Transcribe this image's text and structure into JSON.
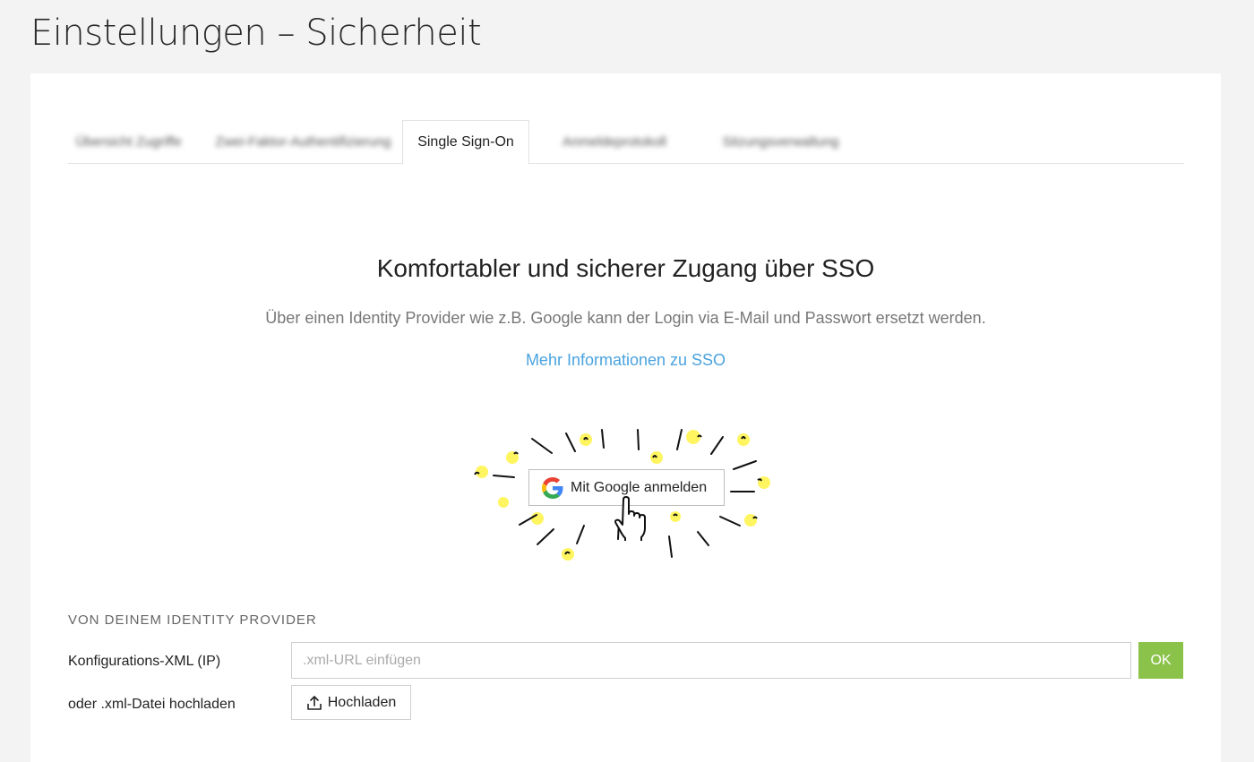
{
  "page": {
    "title": "Einstellungen – Sicherheit"
  },
  "tabs": [
    {
      "label": "Übersicht Zugriffe",
      "active": false,
      "blurred": true
    },
    {
      "label": "Zwei-Faktor-Authentifizierung",
      "active": false,
      "blurred": true
    },
    {
      "label": "Single Sign-On",
      "active": true,
      "blurred": false
    },
    {
      "label": "Anmeldeprotokoll",
      "active": false,
      "blurred": true
    },
    {
      "label": "Sitzungsverwaltung",
      "active": false,
      "blurred": true
    }
  ],
  "sso": {
    "headline": "Komfortabler und sicherer Zugang über SSO",
    "description": "Über einen Identity Provider wie z.B. Google kann der Login via E-Mail und Passwort ersetzt werden.",
    "info_link": "Mehr Informationen zu SSO",
    "google_button_label": "Mit Google anmelden"
  },
  "identity_provider": {
    "section_title": "VON DEINEM IDENTITY PROVIDER",
    "xml_label": "Konfigurations-XML (IP)",
    "xml_placeholder": ".xml-URL einfügen",
    "xml_value": "",
    "ok_label": "OK",
    "upload_label": "oder .xml-Datei hochladen",
    "upload_button_label": "Hochladen"
  },
  "colors": {
    "accent_green": "#8bc34a",
    "link_blue": "#4aa3df",
    "highlight_yellow": "#fff200"
  },
  "icons": {
    "google": "google-g-icon",
    "cursor": "hand-pointer-icon",
    "upload": "upload-icon"
  }
}
